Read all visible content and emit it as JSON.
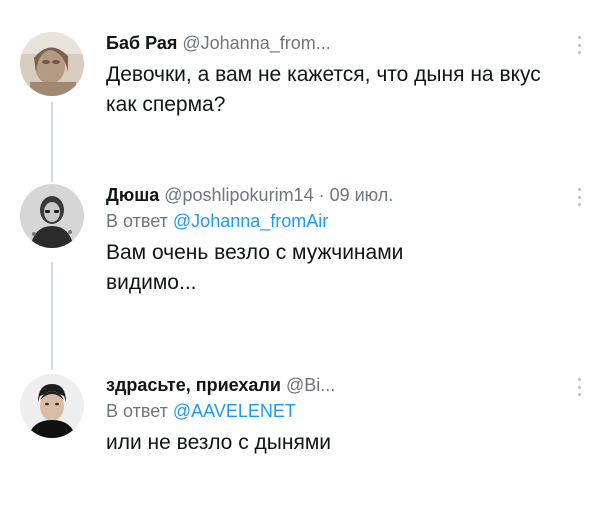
{
  "tweets": [
    {
      "author": "Баб Рая",
      "handle": "@Johanna_from...",
      "text": "Девочки, а вам не кажется, что дыня на вкус как сперма?",
      "avatar_icon": "user-avatar-icon"
    },
    {
      "author": "Дюша",
      "handle": "@poshlipokurim14",
      "separator": "·",
      "date": "09 июл.",
      "reply_prefix": "В ответ",
      "reply_to": "@Johanna_fromAir",
      "text": "Вам очень везло с мужчинами видимо...",
      "avatar_icon": "user-avatar-icon"
    },
    {
      "author": "здрасьте, приехали",
      "handle": "@Bi...",
      "reply_prefix": "В ответ",
      "reply_to": "@AAVELENET",
      "text": "или не везло с дынями",
      "avatar_icon": "user-avatar-icon"
    }
  ],
  "more_icon": "more-options-icon",
  "colors": {
    "text": "#0f1419",
    "secondary": "#6b7680",
    "link": "#1d9bf0",
    "thread_line": "#cfd9de"
  }
}
